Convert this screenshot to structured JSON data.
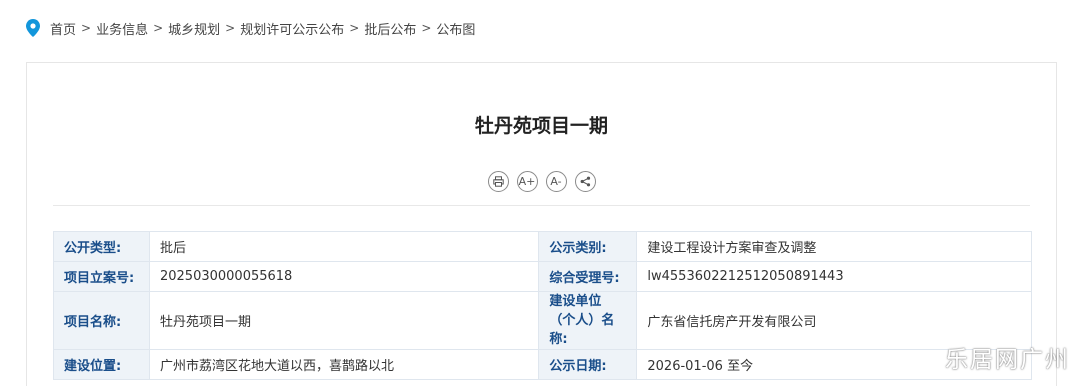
{
  "breadcrumb": {
    "items": [
      "首页",
      "业务信息",
      "城乡规划",
      "规划许可公示公布",
      "批后公布",
      "公布图"
    ],
    "separator": ">",
    "icon_color": "#1296db"
  },
  "page_title": "牡丹苑项目一期",
  "tools": [
    {
      "icon": "print-icon",
      "label": ""
    },
    {
      "icon": "font-increase-icon",
      "label": "A+"
    },
    {
      "icon": "font-decrease-icon",
      "label": "A-"
    },
    {
      "icon": "share-icon",
      "label": ""
    }
  ],
  "info_table": {
    "rows": [
      {
        "label1": "公开类型:",
        "value1": "批后",
        "label2": "公示类别:",
        "value2": "建设工程设计方案审查及调整"
      },
      {
        "label1": "项目立案号:",
        "value1": "2025030000055618",
        "label2": "综合受理号:",
        "value2": "lw4553602212512050891443"
      },
      {
        "label1": "项目名称:",
        "value1": "牡丹苑项目一期",
        "label2": "建设单位（个人）名称:",
        "value2": "广东省信托房产开发有限公司"
      },
      {
        "label1": "建设位置:",
        "value1": "广州市荔湾区花地大道以西，喜鹊路以北",
        "label2": "公示日期:",
        "value2": "2026-01-06 至今"
      }
    ]
  },
  "watermark": "乐居网广州",
  "colors": {
    "label_text": "#1a4e8a",
    "label_bg": "#eef3f8",
    "border": "#dfe6ee"
  }
}
